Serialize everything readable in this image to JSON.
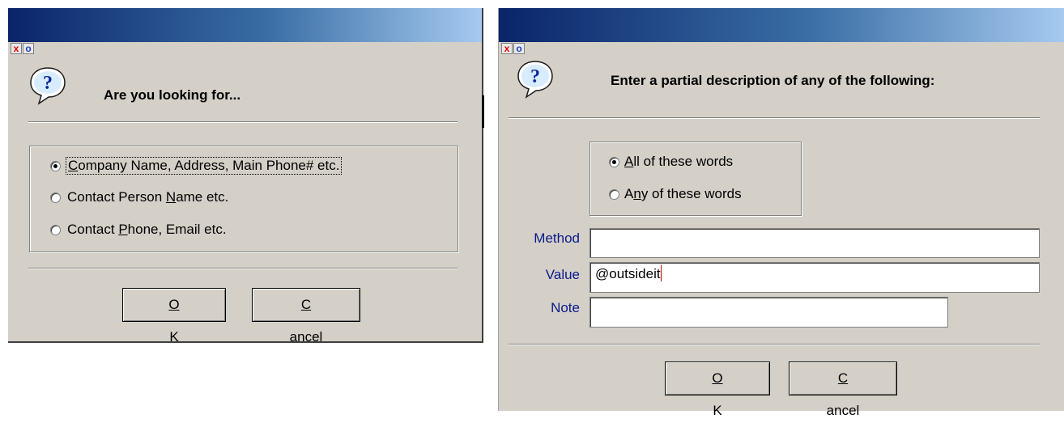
{
  "dialog1": {
    "sys_buttons": {
      "close": "x",
      "restore": "o"
    },
    "heading": "Are you looking for...",
    "options": [
      {
        "prefix": "",
        "accel": "C",
        "rest": "ompany Name, Address, Main Phone# etc.",
        "selected": true
      },
      {
        "prefix": "Contact Person ",
        "accel": "N",
        "rest": "ame etc.",
        "selected": false
      },
      {
        "prefix": "Contact ",
        "accel": "P",
        "rest": "hone, Email etc.",
        "selected": false
      }
    ],
    "ok": {
      "accel": "O",
      "rest": "K"
    },
    "cancel": {
      "accel": "C",
      "rest": "ancel"
    }
  },
  "dialog2": {
    "sys_buttons": {
      "close": "x",
      "restore": "o"
    },
    "heading": "Enter a partial description of any of the following:",
    "options": [
      {
        "prefix": "",
        "accel": "A",
        "rest": "ll of these words",
        "selected": true
      },
      {
        "prefix": "A",
        "accel": "n",
        "rest": "y of these words",
        "selected": false
      }
    ],
    "fields": {
      "method": {
        "label": "Method",
        "value": ""
      },
      "value": {
        "label": "Value",
        "value": "@outsideit"
      },
      "note": {
        "label": "Note",
        "value": ""
      }
    },
    "ok": {
      "accel": "O",
      "rest": "K"
    },
    "cancel": {
      "accel": "C",
      "rest": "ancel"
    }
  },
  "colors": {
    "dialog_bg": "#d4d0c8",
    "title_start": "#0a246a",
    "title_end": "#a6caf0",
    "label_blue": "#0a1a8a"
  },
  "icons": [
    "question-balloon-icon",
    "close-icon",
    "restore-icon",
    "radio-checked",
    "radio-unchecked"
  ]
}
